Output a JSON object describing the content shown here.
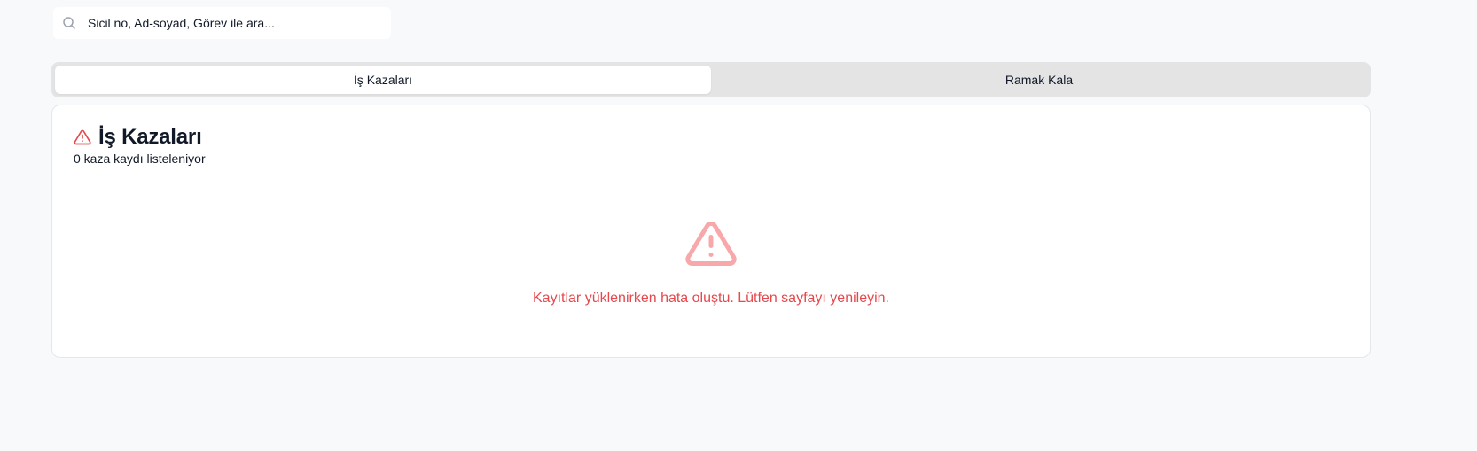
{
  "search": {
    "placeholder": "Sicil no, Ad-soyad, Görev ile ara...",
    "value": "",
    "icon": "search-icon"
  },
  "tabs": [
    {
      "label": "İş Kazaları",
      "active": true
    },
    {
      "label": "Ramak Kala",
      "active": false
    }
  ],
  "section": {
    "title": "İş Kazaları",
    "title_icon": "warning-triangle-icon",
    "subtitle": "0 kaza kaydı listeleniyor"
  },
  "empty_state": {
    "icon": "warning-triangle-icon",
    "message": "Kayıtlar yüklenirken hata oluştu. Lütfen sayfayı yenileyin."
  },
  "colors": {
    "danger": "#e5484d",
    "danger_light": "#f8a8aa",
    "tab_track": "#e4e4e5",
    "background": "#f8f9fb"
  }
}
